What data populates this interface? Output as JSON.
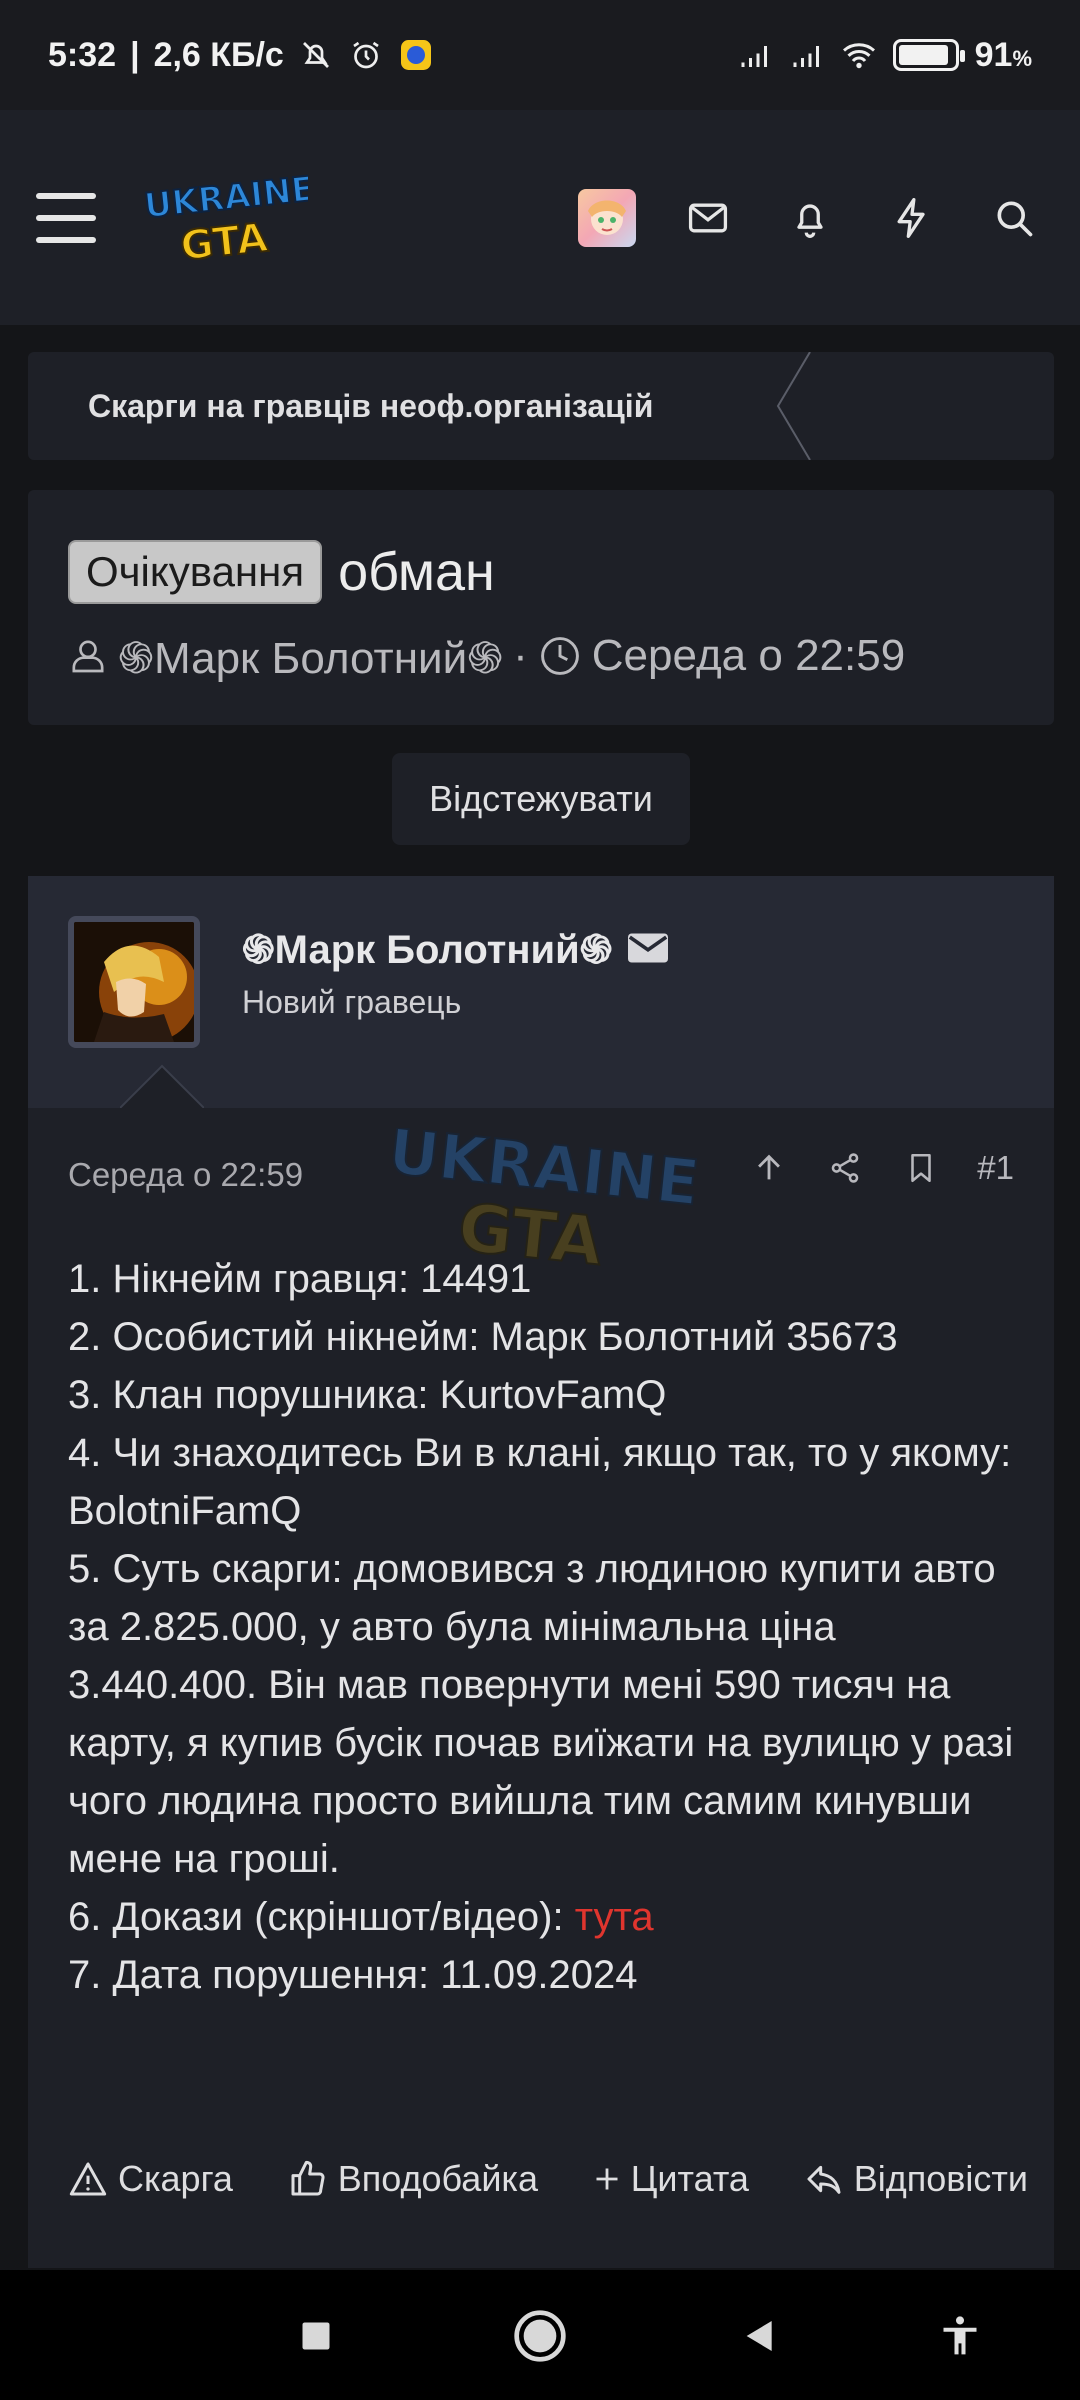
{
  "status_bar": {
    "time": "5:32",
    "separator": "|",
    "speed": "2,6 КБ/с",
    "battery": "91",
    "battery_unit": "%",
    "battery_level": 0.91,
    "icons": [
      "mute-icon",
      "alarm-icon",
      "app-notification-icon",
      "signal-icon",
      "signal-icon",
      "wifi-icon",
      "battery-icon"
    ]
  },
  "header": {
    "logo_line1": "UKRAINE",
    "logo_line2": "GTA",
    "icons": [
      "menu-icon",
      "user-avatar",
      "mail-icon",
      "bell-icon",
      "lightning-icon",
      "search-icon"
    ]
  },
  "breadcrumb": {
    "label": "Скарги на гравців неоф.організацій"
  },
  "thread": {
    "badge": "Очікування",
    "title": "обман",
    "author": "֍Марк Болотний֍",
    "dot": "·",
    "date": "Середа о 22:59",
    "follow_label": "Відстежувати"
  },
  "post": {
    "author": "֍Марк Болотний֍",
    "role": "Новий гравець",
    "date": "Середа о 22:59",
    "number": "#1",
    "lines": [
      "1. Нікнейм гравця: 14491",
      "2. Особистий нікнейм: Марк Болотний 35673",
      "3. Клан порушника: KurtovFamQ",
      "4. Чи знаходитесь Ви в клані, якщо так, то у якому: BolotniFamQ",
      "5. Суть скарги: домовився з людиною купити авто за 2.825.000, у авто була мінімальна ціна 3.440.400. Він мав повернути мені 590 тисяч на карту, я купив бусік почав виїжати на вулицю у разі чого людина просто вийшла тим самим кинувши мене на гроші."
    ],
    "proof_prefix": "6. Докази (скріншот/відео): ",
    "proof_link": "тута",
    "violation_date": "7. Дата порушення: 11.09.2024",
    "actions": {
      "report": "Скарга",
      "like": "Вподобайка",
      "quote": "Цитата",
      "reply": "Відповісти"
    }
  },
  "colors": {
    "background": "#141518",
    "panel": "#1e2027",
    "post_header": "#262934",
    "link_red": "#e0352e"
  }
}
